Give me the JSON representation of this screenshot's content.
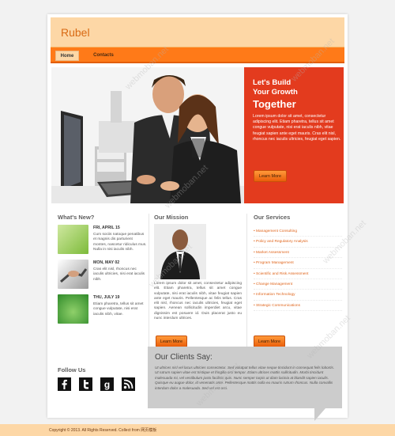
{
  "brand": {
    "logo": "Rubel"
  },
  "nav": {
    "items": [
      "Home",
      "Contacts"
    ],
    "active": "Home"
  },
  "hero": {
    "line1": "Let's Build",
    "line2": "Your Growth",
    "line3": "Together",
    "body": "Lorem ipsum dolor sit amet, consectetur adipiscing elit. Etiam pharetra, tellus sit amet congue vulputate, nisi erat iaculis nibh, vitae feugiat sapien ante eget mauris. Cras elit nisl, rhoncus nec iaculis ultricies, feugiat eget sapien.",
    "button": "Learn More"
  },
  "news": {
    "title": "What's New?",
    "items": [
      {
        "date": "FRI, APRIL 15",
        "text": "Cum sociis natoque penatibus et magnis dis parturient montes, nascetur ridiculus mus. Nulla in nisi iaculis nibh."
      },
      {
        "date": "MON, MAY 02",
        "text": "Cras elit nisl, rhoncus nec iaculis ultricies, nisi erat iaculis nibh."
      },
      {
        "date": "THU, JULY 19",
        "text": "Etiam pharetra, tellus sit amet congue vulputate, nisi erat iaculis nibh, vitae."
      }
    ]
  },
  "mission": {
    "title": "Our Mission",
    "text": "Lorem ipsum dolor sit amet, consectetur adipiscing elit. Etiam pharetra, tellus sit amet congue vulputate, nisi erat iaculis nibh, vitae feugiat sapien ante eget mauris. Pellentesque ac felis tellus. Cras elit nisl, rhoncus nec iaculis ultricies, feugiat eget sapien. Aenean sollicitudin imperdiet arcu, vitae dignissim est posuere id. Duis placerat justo eu nunc interdum ultrices.",
    "button": "Learn More"
  },
  "services": {
    "title": "Our Services",
    "items": [
      "Management Consulting",
      "Policy and Regulatory Analysis",
      "Market Assessment",
      "Program Management",
      "Scientific and Risk Assessment",
      "Change Management",
      "Information Technology",
      "Strategic Communications"
    ],
    "button": "Learn More"
  },
  "follow": {
    "title": "Follow Us",
    "icons": [
      "facebook-icon",
      "twitter-icon",
      "google-icon",
      "rss-icon"
    ]
  },
  "clients": {
    "title": "Our Clients Say:",
    "quote": "Ut ultrices nisl vel lacus ultricies consectetur. Sed volutpat tellus vitae neque tincidunt in consequat felis lobortis. Ut rutrum sapien vitae est tristique et fringilla orci tempor. Etiam ultrices mattis sollicitudin. Morbi tincidunt malesuada mi, vel vestibulum justo facilisis quis. Nunc semper turpis ut diam lacinia at blandit sapien iaculis. Quisque eu augue dolor, id venenatis ante. Pellentesque mattis nulla eu mauris rutrum rhoncus. Nulla convallis interdum dolor a malesuada. Sed vel est orci."
  },
  "footer": {
    "text": "Copyright © 2013. All Rights Reserved. Collect from 网页模板"
  },
  "watermark": {
    "text": "webmoban.net"
  },
  "colors": {
    "accent": "#ff7a18",
    "hero_bg": "#e33b1e",
    "header_bg": "#fdd7a6"
  }
}
